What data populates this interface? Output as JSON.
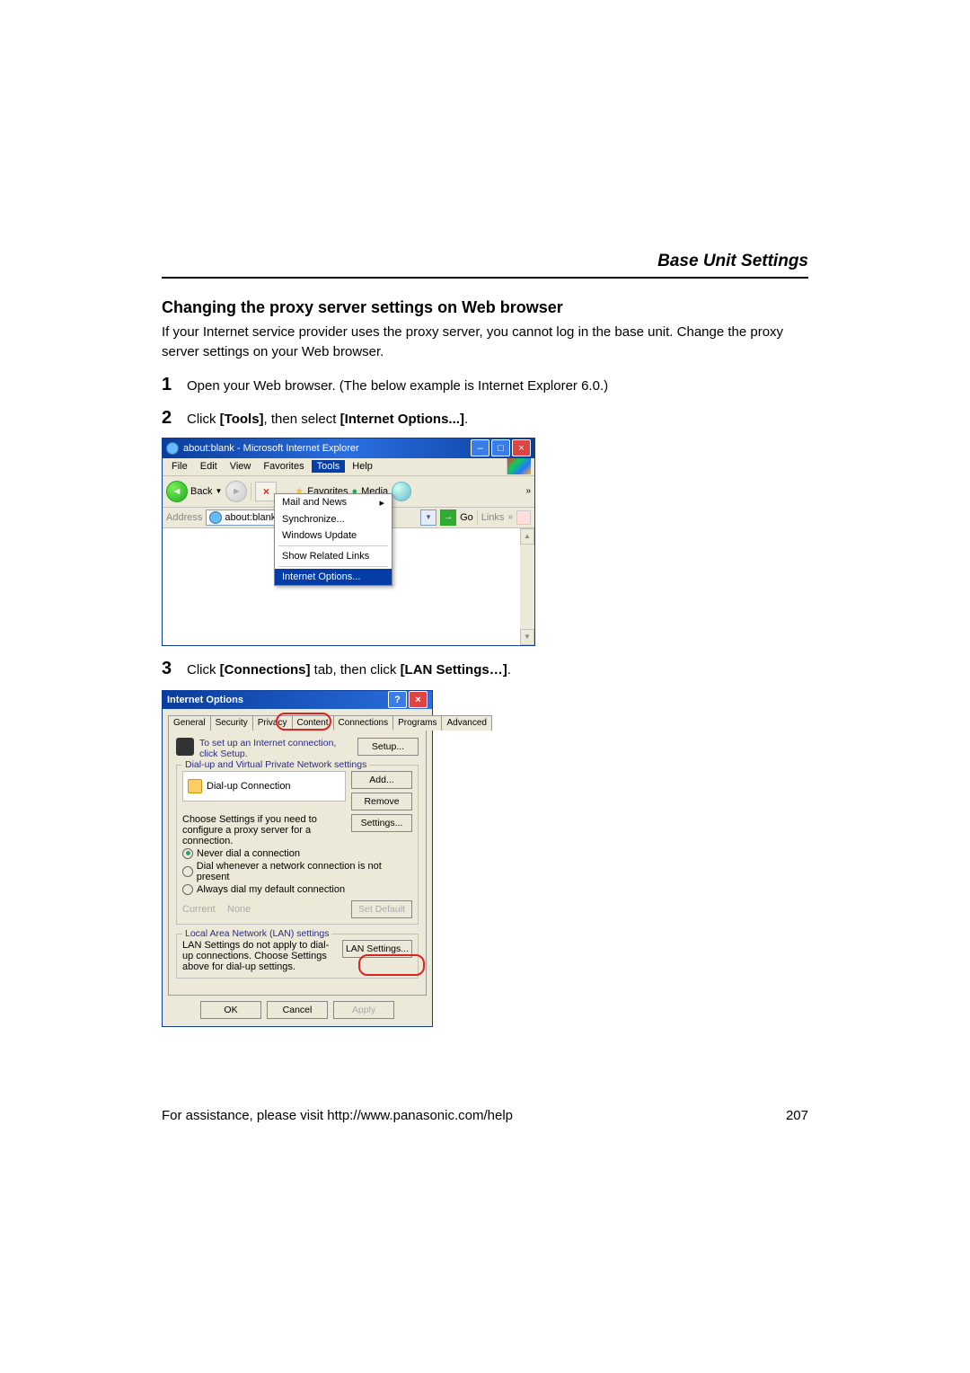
{
  "header": {
    "title": "Base Unit Settings"
  },
  "section": {
    "title": "Changing the proxy server settings on Web browser"
  },
  "intro": "If your Internet service provider uses the proxy server, you cannot log in the base unit. Change the proxy server settings on your Web browser.",
  "steps": {
    "s1": {
      "num": "1",
      "text": "Open your Web browser. (The below example is Internet Explorer 6.0.)"
    },
    "s2": {
      "num": "2",
      "pre": "Click ",
      "b1": "[Tools]",
      "mid": ", then select ",
      "b2": "[Internet Options...]",
      "post": "."
    },
    "s3": {
      "num": "3",
      "pre": "Click ",
      "b1": "[Connections]",
      "mid": " tab, then click ",
      "b2": "[LAN Settings…]",
      "post": "."
    }
  },
  "ie": {
    "title": "about:blank - Microsoft Internet Explorer",
    "menus": {
      "file": "File",
      "edit": "Edit",
      "view": "View",
      "favorites": "Favorites",
      "tools": "Tools",
      "help": "Help"
    },
    "toolbar": {
      "back": "Back",
      "favorites": "Favorites",
      "media": "Media"
    },
    "address": {
      "label": "Address",
      "value": "about:blank",
      "go": "Go",
      "links": "Links"
    },
    "toolsMenu": [
      "Mail and News",
      "Synchronize...",
      "Windows Update",
      "Show Related Links",
      "Internet Options..."
    ]
  },
  "io": {
    "title": "Internet Options",
    "tabs": [
      "General",
      "Security",
      "Privacy",
      "Content",
      "Connections",
      "Programs",
      "Advanced"
    ],
    "setupText": "To set up an Internet connection, click Setup.",
    "setupBtn": "Setup...",
    "dialLegend": "Dial-up and Virtual Private Network settings",
    "dialItem": "Dial-up Connection",
    "addBtn": "Add...",
    "removeBtn": "Remove",
    "proxyText": "Choose Settings if you need to configure a proxy server for a connection.",
    "proxyBtn": "Settings...",
    "radios": {
      "r1": "Never dial a connection",
      "r2": "Dial whenever a network connection is not present",
      "r3": "Always dial my default connection"
    },
    "currentLbl": "Current",
    "currentVal": "None",
    "setDefault": "Set Default",
    "lanLegend": "Local Area Network (LAN) settings",
    "lanText": "LAN Settings do not apply to dial-up connections. Choose Settings above for dial-up settings.",
    "lanBtn": "LAN Settings...",
    "okBtn": "OK",
    "cancelBtn": "Cancel",
    "applyBtn": "Apply"
  },
  "footer": {
    "text": "For assistance, please visit http://www.panasonic.com/help",
    "page": "207"
  }
}
